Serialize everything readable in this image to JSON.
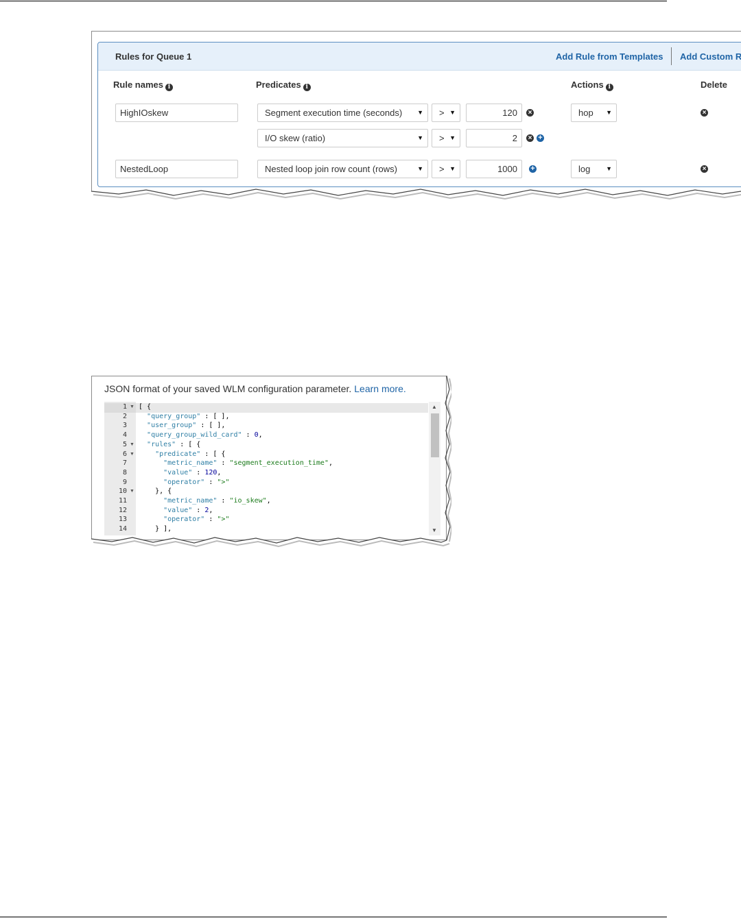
{
  "rules_panel": {
    "title": "Rules for Queue 1",
    "add_rule_from_templates": "Add Rule from Templates",
    "add_custom_rule": "Add Custom Ru",
    "columns": {
      "rule_names": "Rule names",
      "predicates": "Predicates",
      "actions": "Actions",
      "delete": "Delete"
    },
    "info_glyph": "i",
    "remove_glyph": "×",
    "add_glyph": "+",
    "dropdown_arrow": "▼",
    "rules": [
      {
        "name": "HighIOskew",
        "predicates": [
          {
            "metric": "Segment execution time (seconds)",
            "operator": ">",
            "value": "120"
          },
          {
            "metric": "I/O skew (ratio)",
            "operator": ">",
            "value": "2"
          }
        ],
        "action": "hop"
      },
      {
        "name": "NestedLoop",
        "predicates": [
          {
            "metric": "Nested loop join row count (rows)",
            "operator": ">",
            "value": "1000"
          }
        ],
        "action": "log"
      }
    ]
  },
  "json_view": {
    "caption": "JSON format of your saved WLM configuration parameter.",
    "learn_more": "Learn more.",
    "line_numbers": [
      "1",
      "2",
      "3",
      "4",
      "5",
      "6",
      "7",
      "8",
      "9",
      "10",
      "11",
      "12",
      "13",
      "14"
    ],
    "fold_marker": "▼",
    "code_lines": [
      "[ {",
      "  \"query_group\" : [ ],",
      "  \"user_group\" : [ ],",
      "  \"query_group_wild_card\" : 0,",
      "  \"rules\" : [ {",
      "    \"predicate\" : [ {",
      "      \"metric_name\" : \"segment_execution_time\",",
      "      \"value\" : 120,",
      "      \"operator\" : \">\"",
      "    }, {",
      "      \"metric_name\" : \"io_skew\",",
      "      \"value\" : 2,",
      "      \"operator\" : \">\"",
      "    } ],"
    ],
    "scroll_up": "▲",
    "scroll_down": "▼"
  },
  "colors": {
    "link": "#1f64a6",
    "header_bg": "#e6f0fa",
    "panel_border": "#5b8ec0",
    "json_key": "#2f7fa5",
    "json_string": "#1a7a1a",
    "json_number": "#00009a"
  }
}
